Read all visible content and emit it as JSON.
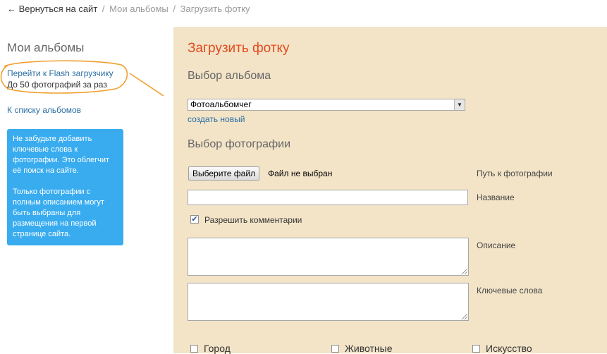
{
  "breadcrumb": {
    "back": "← Вернуться на сайт",
    "sep": "/",
    "albums": "Мои альбомы",
    "current": "Загрузить фотку"
  },
  "sidebar": {
    "title": "Мои альбомы",
    "flash_link": "Перейти к Flash загрузчику",
    "flash_note": "До 50 фотографий за раз",
    "albums_link": "К списку альбомов",
    "info_p1": "Не забудьте добавить ключевые слова к фотографии. Это облегчит её поиск на сайте.",
    "info_p2": "Только фотографии с полным описанием могут быть выбраны для размещения на первой странице сайта."
  },
  "form": {
    "title": "Загрузить фотку",
    "album_section": "Выбор альбома",
    "album_selected": "Фотоальбомчег",
    "create_new": "создать новый",
    "photo_section": "Выбор фотографии",
    "file_button": "Выберите файл",
    "file_status": "Файл не выбран",
    "path_label": "Путь к фотографии",
    "name_label": "Название",
    "name_value": "",
    "comments_label": "Разрешить комментарии",
    "comments_checked": true,
    "description_label": "Описание",
    "keywords_label": "Ключевые слова",
    "categories": [
      "Город",
      "Животные",
      "Искусство"
    ]
  },
  "colors": {
    "panel_bg": "#f3e4c8",
    "title_accent": "#e34a1c",
    "info_box": "#39acf0",
    "link": "#2b6ea3",
    "annotation": "#f0a030"
  }
}
